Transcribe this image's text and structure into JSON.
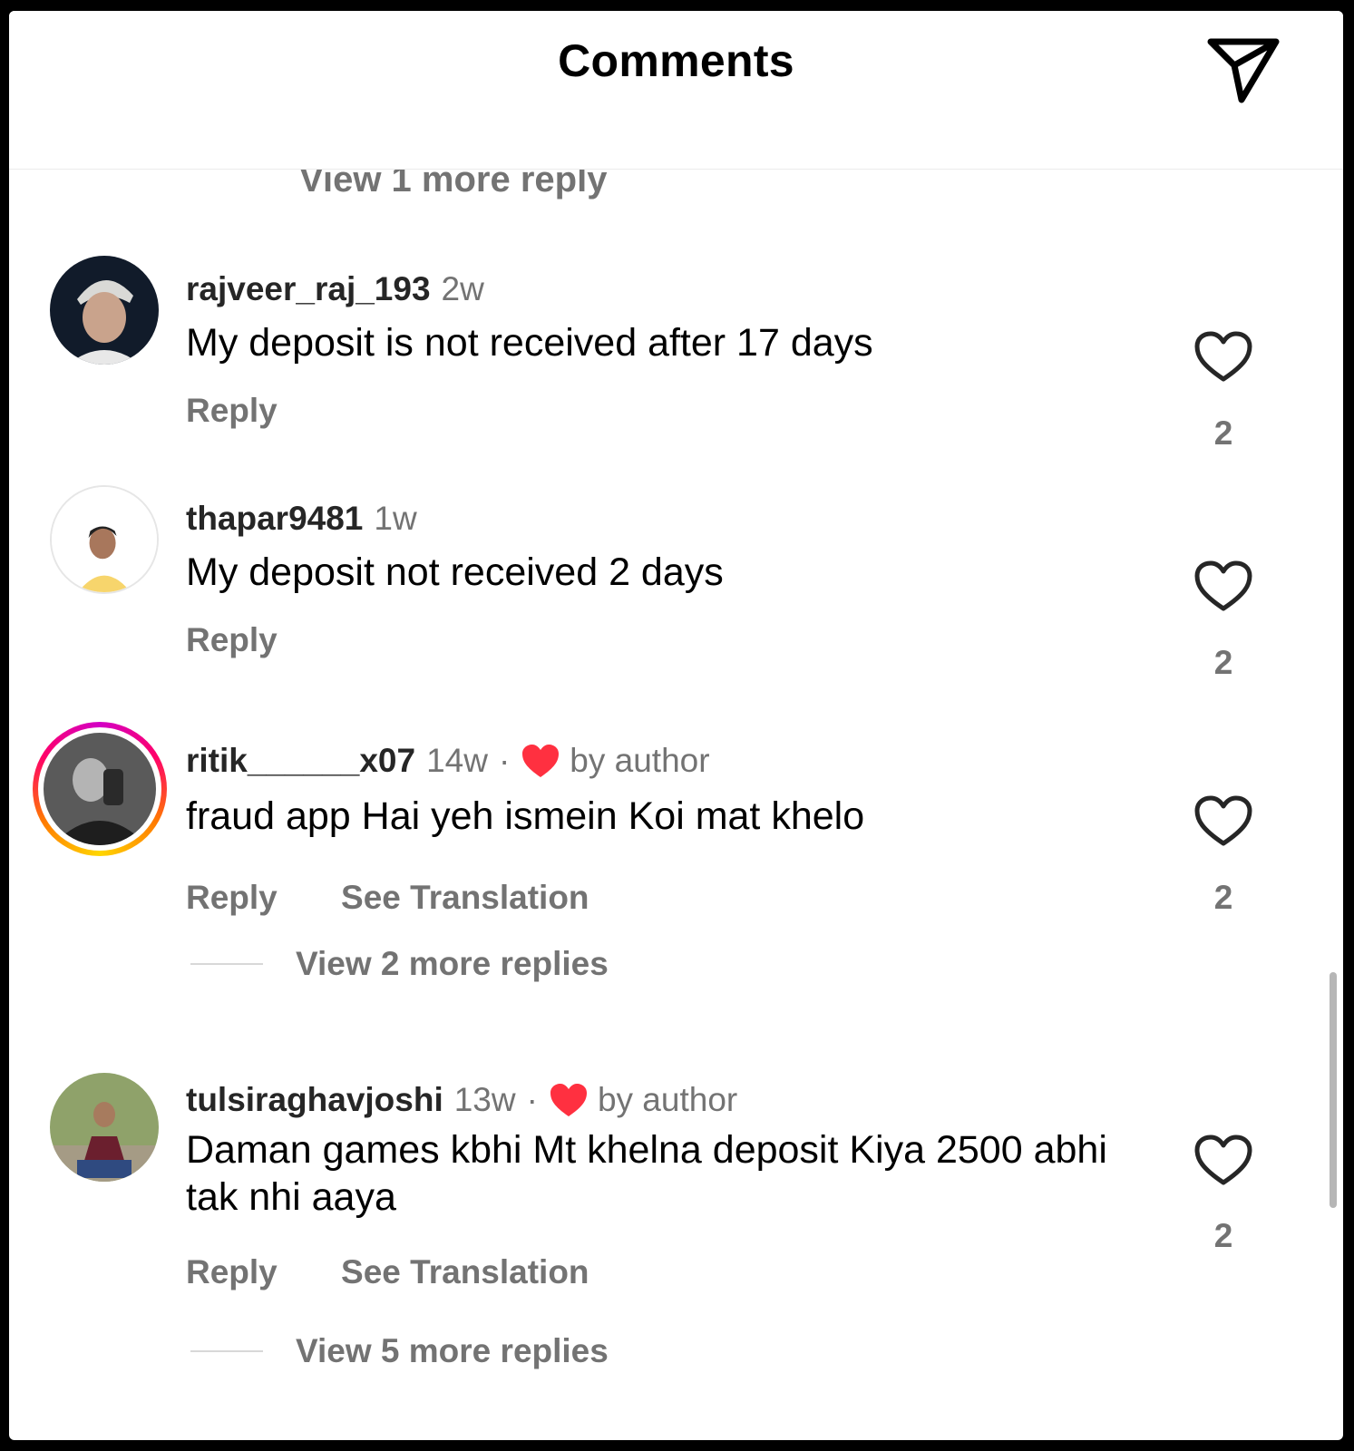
{
  "header": {
    "title": "Comments"
  },
  "peek_text": "View 1 more reply",
  "comments": [
    {
      "username": "rajveer_raj_193",
      "time": "2w",
      "text": "My deposit is not received after 17 days",
      "reply_label": "Reply",
      "like_count": "2"
    },
    {
      "username": "thapar9481",
      "time": "1w",
      "text": "My deposit not received 2 days",
      "reply_label": "Reply",
      "like_count": "2"
    },
    {
      "username": "ritik______x07",
      "time": "14w",
      "dot": "·",
      "author_badge": "by author",
      "text": "fraud app Hai yeh ismein Koi mat khelo",
      "reply_label": "Reply",
      "translation_label": "See Translation",
      "like_count": "2",
      "more_replies": "View 2 more replies",
      "has_story_ring": true
    },
    {
      "username": "tulsiraghavjoshi",
      "time": "13w",
      "dot": "·",
      "author_badge": "by author",
      "text": "Daman games kbhi Mt khelna deposit Kiya 2500 abhi tak nhi aaya",
      "reply_label": "Reply",
      "translation_label": "See Translation",
      "like_count": "2",
      "more_replies": "View 5 more replies"
    }
  ],
  "icons": {
    "send": "send-icon",
    "like": "heart-outline-icon",
    "author_like": "heart-filled-icon"
  },
  "colors": {
    "author_heart": "#ff3040",
    "secondary_text": "#737373"
  }
}
